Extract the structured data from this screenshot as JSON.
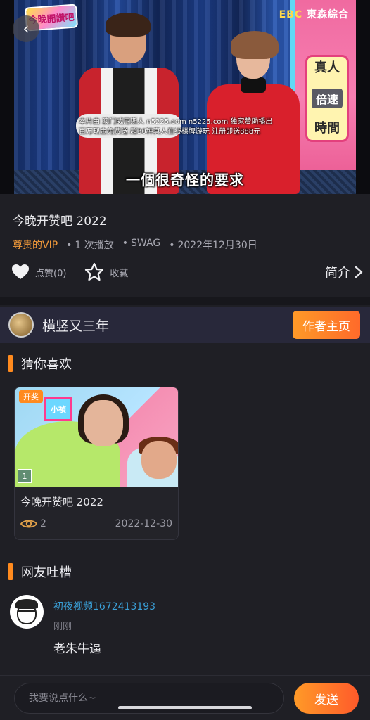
{
  "player": {
    "show_logo": "今晚開讚吧",
    "channel_logo_prefix": "EBC",
    "channel_logo_name": "東森綜合",
    "subtitle": "一個很奇怪的要求",
    "ad_line_1": "本片由 澳门威尼斯人 n5225.com n5225.com 独家赞助播出",
    "ad_line_2": "百万现金免费送 超30种真人在线棋牌游玩 注册即送888元",
    "speed_badge_top": "真人",
    "speed_badge_mid": "倍速",
    "speed_badge_bottom": "時間"
  },
  "video": {
    "title": "今晚开赞吧 2022",
    "vip_label": "尊贵的VIP",
    "plays": "1 次播放",
    "tag": "SWAG",
    "date": "2022年12月30日"
  },
  "actions": {
    "like_label": "点赞(0)",
    "favorite_label": "收藏",
    "intro_label": "简介"
  },
  "author": {
    "name": "横竖又三年",
    "homepage_button": "作者主页"
  },
  "recommend": {
    "heading": "猜你喜欢",
    "items": [
      {
        "badge": "开奖",
        "cube_text": "小禎",
        "episode": "1",
        "title": "今晚开赞吧 2022",
        "views": "2",
        "date": "2022-12-30"
      }
    ]
  },
  "comments": {
    "heading": "网友吐槽",
    "items": [
      {
        "user": "初夜视频1672413193",
        "time": "刚刚",
        "text": "老朱牛逼"
      }
    ]
  },
  "composer": {
    "placeholder": "我要说点什么~",
    "send_label": "发送"
  },
  "colors": {
    "accent": "#ff8a1e",
    "vip": "#f29a3a",
    "username": "#3aa0d8",
    "background": "#1f1f25"
  }
}
